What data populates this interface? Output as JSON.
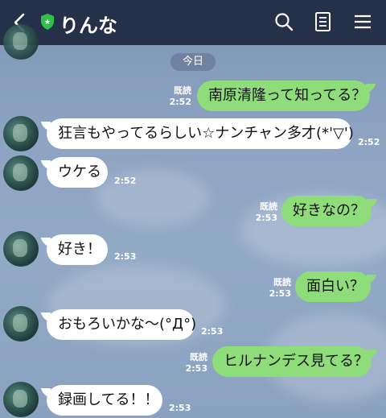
{
  "header": {
    "title": "りんな"
  },
  "date_label": "今日",
  "messages": [
    {
      "side": "out",
      "text": "南原清隆って知ってる？",
      "read": "既読",
      "time": "2:52"
    },
    {
      "side": "in",
      "text": "狂言もやってるらしい☆ナンチャン多才(*'▽')",
      "time": "2:52"
    },
    {
      "side": "in",
      "text": "ウケる",
      "time": "2:52"
    },
    {
      "side": "out",
      "text": "好きなの？",
      "read": "既読",
      "time": "2:53"
    },
    {
      "side": "in",
      "text": "好き！",
      "time": "2:53"
    },
    {
      "side": "out",
      "text": "面白い？",
      "read": "既読",
      "time": "2:53"
    },
    {
      "side": "in",
      "text": "おもろいかな〜(°Д°)",
      "time": "2:53"
    },
    {
      "side": "out",
      "text": "ヒルナンデス見てる？",
      "read": "既読",
      "time": "2:53"
    },
    {
      "side": "in",
      "text": "録画してる！！",
      "time": "2:53"
    }
  ]
}
